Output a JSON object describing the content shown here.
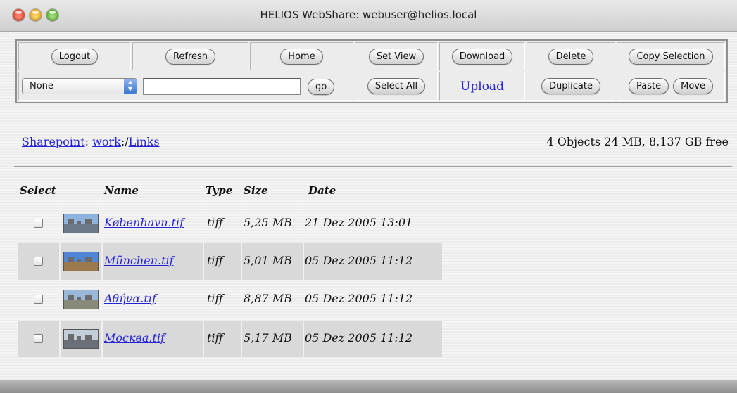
{
  "window": {
    "title": "HELIOS WebShare: webuser@helios.local"
  },
  "toolbar": {
    "logout": "Logout",
    "refresh": "Refresh",
    "home": "Home",
    "set_view": "Set View",
    "download": "Download",
    "delete": "Delete",
    "copy_selection": "Copy Selection",
    "select_value": "None",
    "search_value": "",
    "go": "go",
    "select_all": "Select All",
    "upload": "Upload",
    "duplicate": "Duplicate",
    "paste": "Paste",
    "move": "Move"
  },
  "location": {
    "sharepoint_label": "Sharepoint",
    "separator": ": ",
    "volume": "work",
    "path_sep": ":/",
    "folder": "Links",
    "summary": "4 Objects 24 MB, 8,137 GB free"
  },
  "table": {
    "headers": {
      "select": "Select",
      "name": "Name",
      "type": "Type",
      "size": "Size",
      "date": "Date"
    },
    "rows": [
      {
        "name": "København.tif",
        "type": "tiff",
        "size": "5,25 MB",
        "date": "21 Dez 2005 13:01",
        "sky": "#8fb3e0",
        "ground": "#6c7a88"
      },
      {
        "name": "München.tif",
        "type": "tiff",
        "size": "5,01 MB",
        "date": "05 Dez 2005 11:12",
        "sky": "#4f86d8",
        "ground": "#9a7a4d"
      },
      {
        "name": "Αθήνα.tif",
        "type": "tiff",
        "size": "8,87 MB",
        "date": "05 Dez 2005 11:12",
        "sky": "#9cb8d8",
        "ground": "#8a8a7a"
      },
      {
        "name": "Москва.tif",
        "type": "tiff",
        "size": "5,17 MB",
        "date": "05 Dez 2005 11:12",
        "sky": "#c3cedb",
        "ground": "#6a6f78"
      }
    ]
  }
}
